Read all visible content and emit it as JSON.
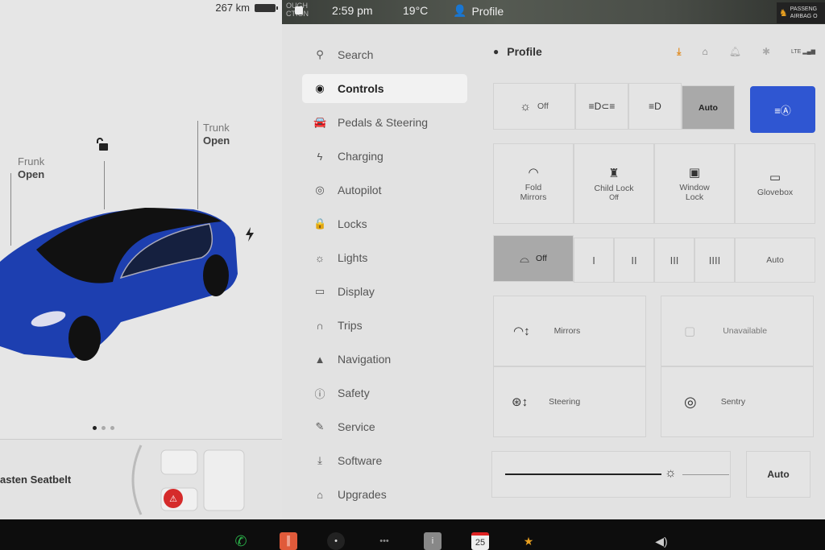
{
  "status": {
    "range": "267 km",
    "street_fragment": "OUGH\nCTION",
    "time": "2:59 pm",
    "temperature": "19°C",
    "profile": "Profile",
    "airbag_line1": "PASSENG",
    "airbag_line2": "AIRBAG O"
  },
  "car_panel": {
    "frunk_label": "Frunk",
    "frunk_state": "Open",
    "trunk_label": "Trunk",
    "trunk_state": "Open",
    "car_color": "#1d3fb0",
    "page_count": 3,
    "active_page": 1,
    "seatbelt_alert": "asten Seatbelt"
  },
  "nav": {
    "items": [
      {
        "label": "Search",
        "icon": "search-icon",
        "glyph": "⚲"
      },
      {
        "label": "Controls",
        "icon": "toggle-icon",
        "glyph": "◉",
        "active": true
      },
      {
        "label": "Pedals & Steering",
        "icon": "car-icon",
        "glyph": "🚘"
      },
      {
        "label": "Charging",
        "icon": "bolt-icon",
        "glyph": "ϟ"
      },
      {
        "label": "Autopilot",
        "icon": "steering-wheel-icon",
        "glyph": "◎"
      },
      {
        "label": "Locks",
        "icon": "lock-icon",
        "glyph": "🔒"
      },
      {
        "label": "Lights",
        "icon": "light-icon",
        "glyph": "☼"
      },
      {
        "label": "Display",
        "icon": "display-icon",
        "glyph": "▭"
      },
      {
        "label": "Trips",
        "icon": "trips-icon",
        "glyph": "∩"
      },
      {
        "label": "Navigation",
        "icon": "navigation-icon",
        "glyph": "▲"
      },
      {
        "label": "Safety",
        "icon": "safety-icon",
        "glyph": "ⓘ"
      },
      {
        "label": "Service",
        "icon": "wrench-icon",
        "glyph": "✎"
      },
      {
        "label": "Software",
        "icon": "download-icon",
        "glyph": "⤓"
      },
      {
        "label": "Upgrades",
        "icon": "bag-icon",
        "glyph": "⌂"
      }
    ]
  },
  "header": {
    "title": "Profile",
    "icons": [
      "download-icon",
      "garage-icon",
      "bell-icon",
      "bluetooth-icon",
      "lte-signal-icon"
    ],
    "lte": "LTE",
    "accent_color": "#e08a1e"
  },
  "lights": {
    "off": "Off",
    "auto": "Auto",
    "selected": "Auto",
    "auto_high_beam_color": "#2f56d2"
  },
  "quick": {
    "fold_mirrors": "Fold\nMirrors",
    "child_lock": "Child Lock",
    "child_lock_state": "Off",
    "window_lock": "Window\nLock",
    "glovebox": "Glovebox"
  },
  "wipers": {
    "off": "Off",
    "speeds": [
      "I",
      "II",
      "III",
      "IIII"
    ],
    "auto": "Auto",
    "selected": "Off"
  },
  "adjust": {
    "mirrors": "Mirrors",
    "unavailable": "Unavailable",
    "steering": "Steering",
    "sentry": "Sentry"
  },
  "brightness": {
    "value_percent": 78,
    "auto": "Auto"
  },
  "dock": {
    "calendar_day": "25",
    "more": "•••"
  }
}
